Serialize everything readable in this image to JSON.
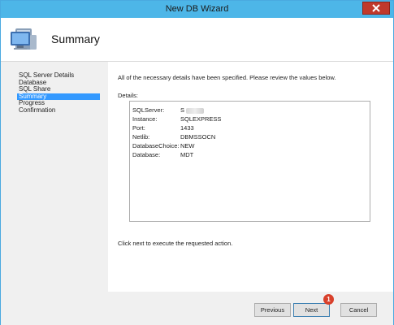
{
  "window": {
    "title": "New DB Wizard"
  },
  "header": {
    "title": "Summary",
    "icon": "computer-monitor-icon"
  },
  "nav": {
    "items": [
      {
        "label": "SQL Server Details"
      },
      {
        "label": "Database"
      },
      {
        "label": "SQL Share"
      },
      {
        "label": "Summary",
        "selected": true
      },
      {
        "label": "Progress"
      },
      {
        "label": "Confirmation"
      }
    ]
  },
  "main": {
    "intro": "All of the necessary details have been specified.  Please review the values below.",
    "details_label": "Details:",
    "details": [
      {
        "key": "SQLServer:",
        "value": "S"
      },
      {
        "key": "Instance:",
        "value": "SQLEXPRESS"
      },
      {
        "key": "Port:",
        "value": "1433"
      },
      {
        "key": "Netlib:",
        "value": "DBMSSOCN"
      },
      {
        "key": "DatabaseChoice:",
        "value": "NEW"
      },
      {
        "key": "Database:",
        "value": "MDT"
      }
    ],
    "footer_note": "Click next to execute the requested action."
  },
  "buttons": {
    "previous": "Previous",
    "next": "Next",
    "cancel": "Cancel",
    "badge": "1"
  },
  "colors": {
    "titlebar": "#4db6e8",
    "close": "#c0392b",
    "selected": "#3399ff",
    "badge": "#d8402b"
  }
}
